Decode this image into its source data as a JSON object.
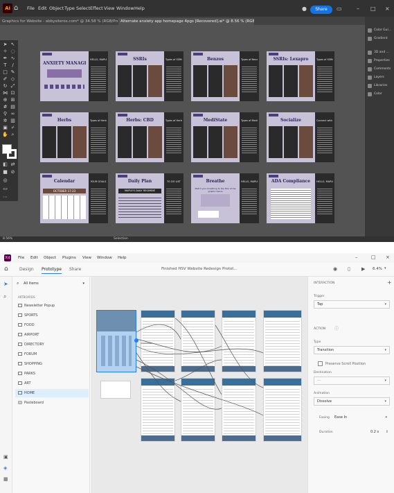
{
  "illustrator": {
    "logo": "Ai",
    "menu": [
      "File",
      "Edit",
      "Object",
      "Type",
      "Select",
      "Effect",
      "View",
      "Window",
      "Help"
    ],
    "share_label": "Share",
    "tabs": [
      "Graphics for Website - abbysiteros.com* @ 34.58 % (RGB/Preview)",
      "Alternate anxiety app homepage 4pgs [Recovered].ai* @ 8.56 % (RGB/Preview)"
    ],
    "zoom": "8.56%",
    "status_tool": "Selection",
    "right_panels": [
      "Color Gui...",
      "Gradient",
      "3D and ...",
      "Properties",
      "Comments",
      "Layers",
      "Libraries",
      "Color"
    ],
    "artboards": [
      {
        "title": "ANXIETY MANAGER",
        "side": "HELLO, MAPLE"
      },
      {
        "title": "SSRIs",
        "side": "Types of SSRIs"
      },
      {
        "title": "Benzos",
        "side": "Types of Benzos"
      },
      {
        "title": "SSRIs: Lexapro",
        "side": "Types of SSRIs"
      },
      {
        "title": "Herbs",
        "side": "Types of Herbs"
      },
      {
        "title": "Herbs: CBD",
        "side": "Types of Herbs"
      },
      {
        "title": "MediState",
        "side": "Types of Meditation"
      },
      {
        "title": "Socialize",
        "side": "Connect with Peers"
      },
      {
        "title": "Calendar",
        "side": "YOUR GOALS"
      },
      {
        "title": "Daily Plan",
        "side": "TO DO LIST"
      },
      {
        "title": "Breathe",
        "side": "HELLO, MAPLE"
      },
      {
        "title": "ADA Compliance",
        "side": "HELLO, MAPLE"
      }
    ],
    "calendar_banner": "OCTOBER 17-23",
    "daily_banner": "MAPLE'S DAILY REGIMINE",
    "breathe_text": "Match your breathing to the flow of the graphic below"
  },
  "xd": {
    "logo": "Xd",
    "menu": [
      "File",
      "Edit",
      "Object",
      "Plugins",
      "View",
      "Window",
      "Help"
    ],
    "modes": [
      "Design",
      "Prototype",
      "Share"
    ],
    "doc_title": "Finished HSV Website Redesign Protot...",
    "zoom": "6.4%",
    "layers_filter": "All Items",
    "section_label": "ARTBOARDS",
    "artboards": [
      "Newsletter Popup",
      "SPORTS",
      "FOOD",
      "AIRPORT",
      "DIRECTORY",
      "FORUM",
      "SHOPPING",
      "PARKS",
      "ART",
      "HOME",
      "Pasteboard"
    ],
    "selected_artboard": "HOME",
    "interaction_label": "INTERACTION",
    "trigger_label": "Trigger",
    "trigger_value": "Tap",
    "action_label": "ACTION",
    "type_label": "Type",
    "type_value": "Transition",
    "preserve_label": "Preserve Scroll Position",
    "destination_label": "Destination",
    "destination_value": "---",
    "animation_label": "Animation",
    "animation_value": "Dissolve",
    "easing_label": "Easing",
    "easing_value": "Ease In",
    "duration_label": "Duration",
    "duration_value": "0.2 s"
  }
}
